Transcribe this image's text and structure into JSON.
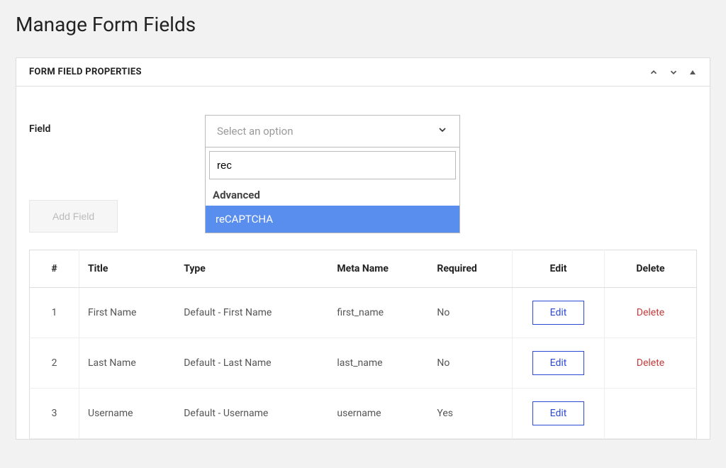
{
  "page": {
    "title": "Manage Form Fields"
  },
  "panel": {
    "title": "FORM FIELD PROPERTIES"
  },
  "field": {
    "label": "Field",
    "select_placeholder": "Select an option",
    "search_value": "rec",
    "group_label": "Advanced",
    "option_highlighted": "reCAPTCHA"
  },
  "buttons": {
    "add_field": "Add Field",
    "edit": "Edit",
    "delete": "Delete"
  },
  "table": {
    "headers": {
      "num": "#",
      "title": "Title",
      "type": "Type",
      "meta": "Meta Name",
      "required": "Required",
      "edit": "Edit",
      "delete": "Delete"
    },
    "rows": [
      {
        "num": "1",
        "title": "First Name",
        "type": "Default - First Name",
        "meta": "first_name",
        "required": "No",
        "deletable": true
      },
      {
        "num": "2",
        "title": "Last Name",
        "type": "Default - Last Name",
        "meta": "last_name",
        "required": "No",
        "deletable": true
      },
      {
        "num": "3",
        "title": "Username",
        "type": "Default - Username",
        "meta": "username",
        "required": "Yes",
        "deletable": false
      }
    ]
  }
}
